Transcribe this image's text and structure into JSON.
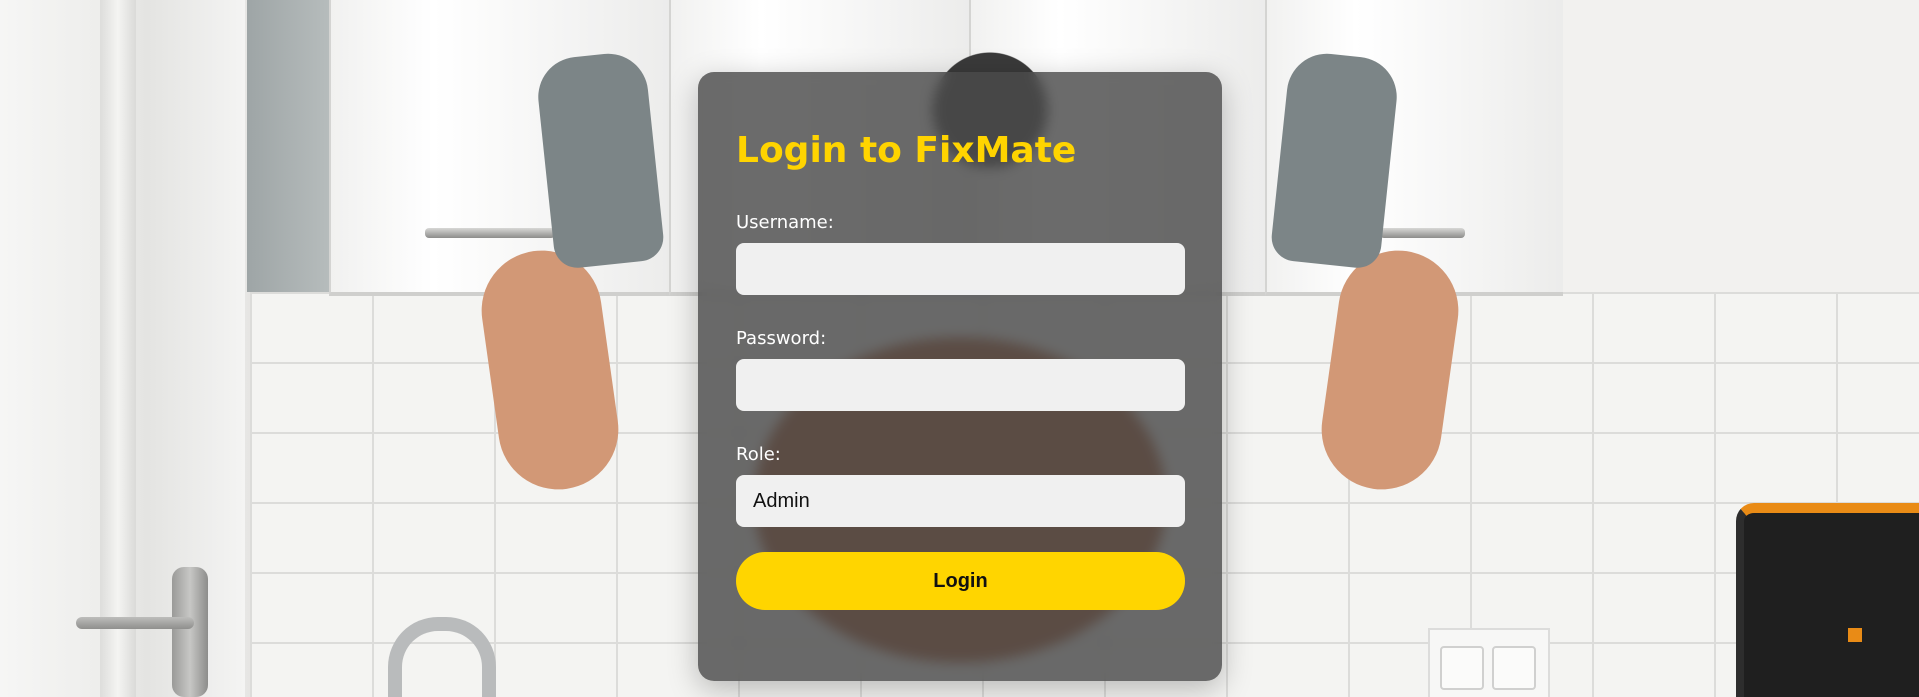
{
  "login": {
    "title": "Login to FixMate",
    "username_label": "Username:",
    "username_value": "",
    "password_label": "Password:",
    "password_value": "",
    "role_label": "Role:",
    "role_selected": "Admin",
    "submit_label": "Login"
  },
  "colors": {
    "accent": "#ffd400",
    "card_background": "#4b4b4b",
    "input_background": "#f0f0f0",
    "label_text": "#ffffff"
  }
}
